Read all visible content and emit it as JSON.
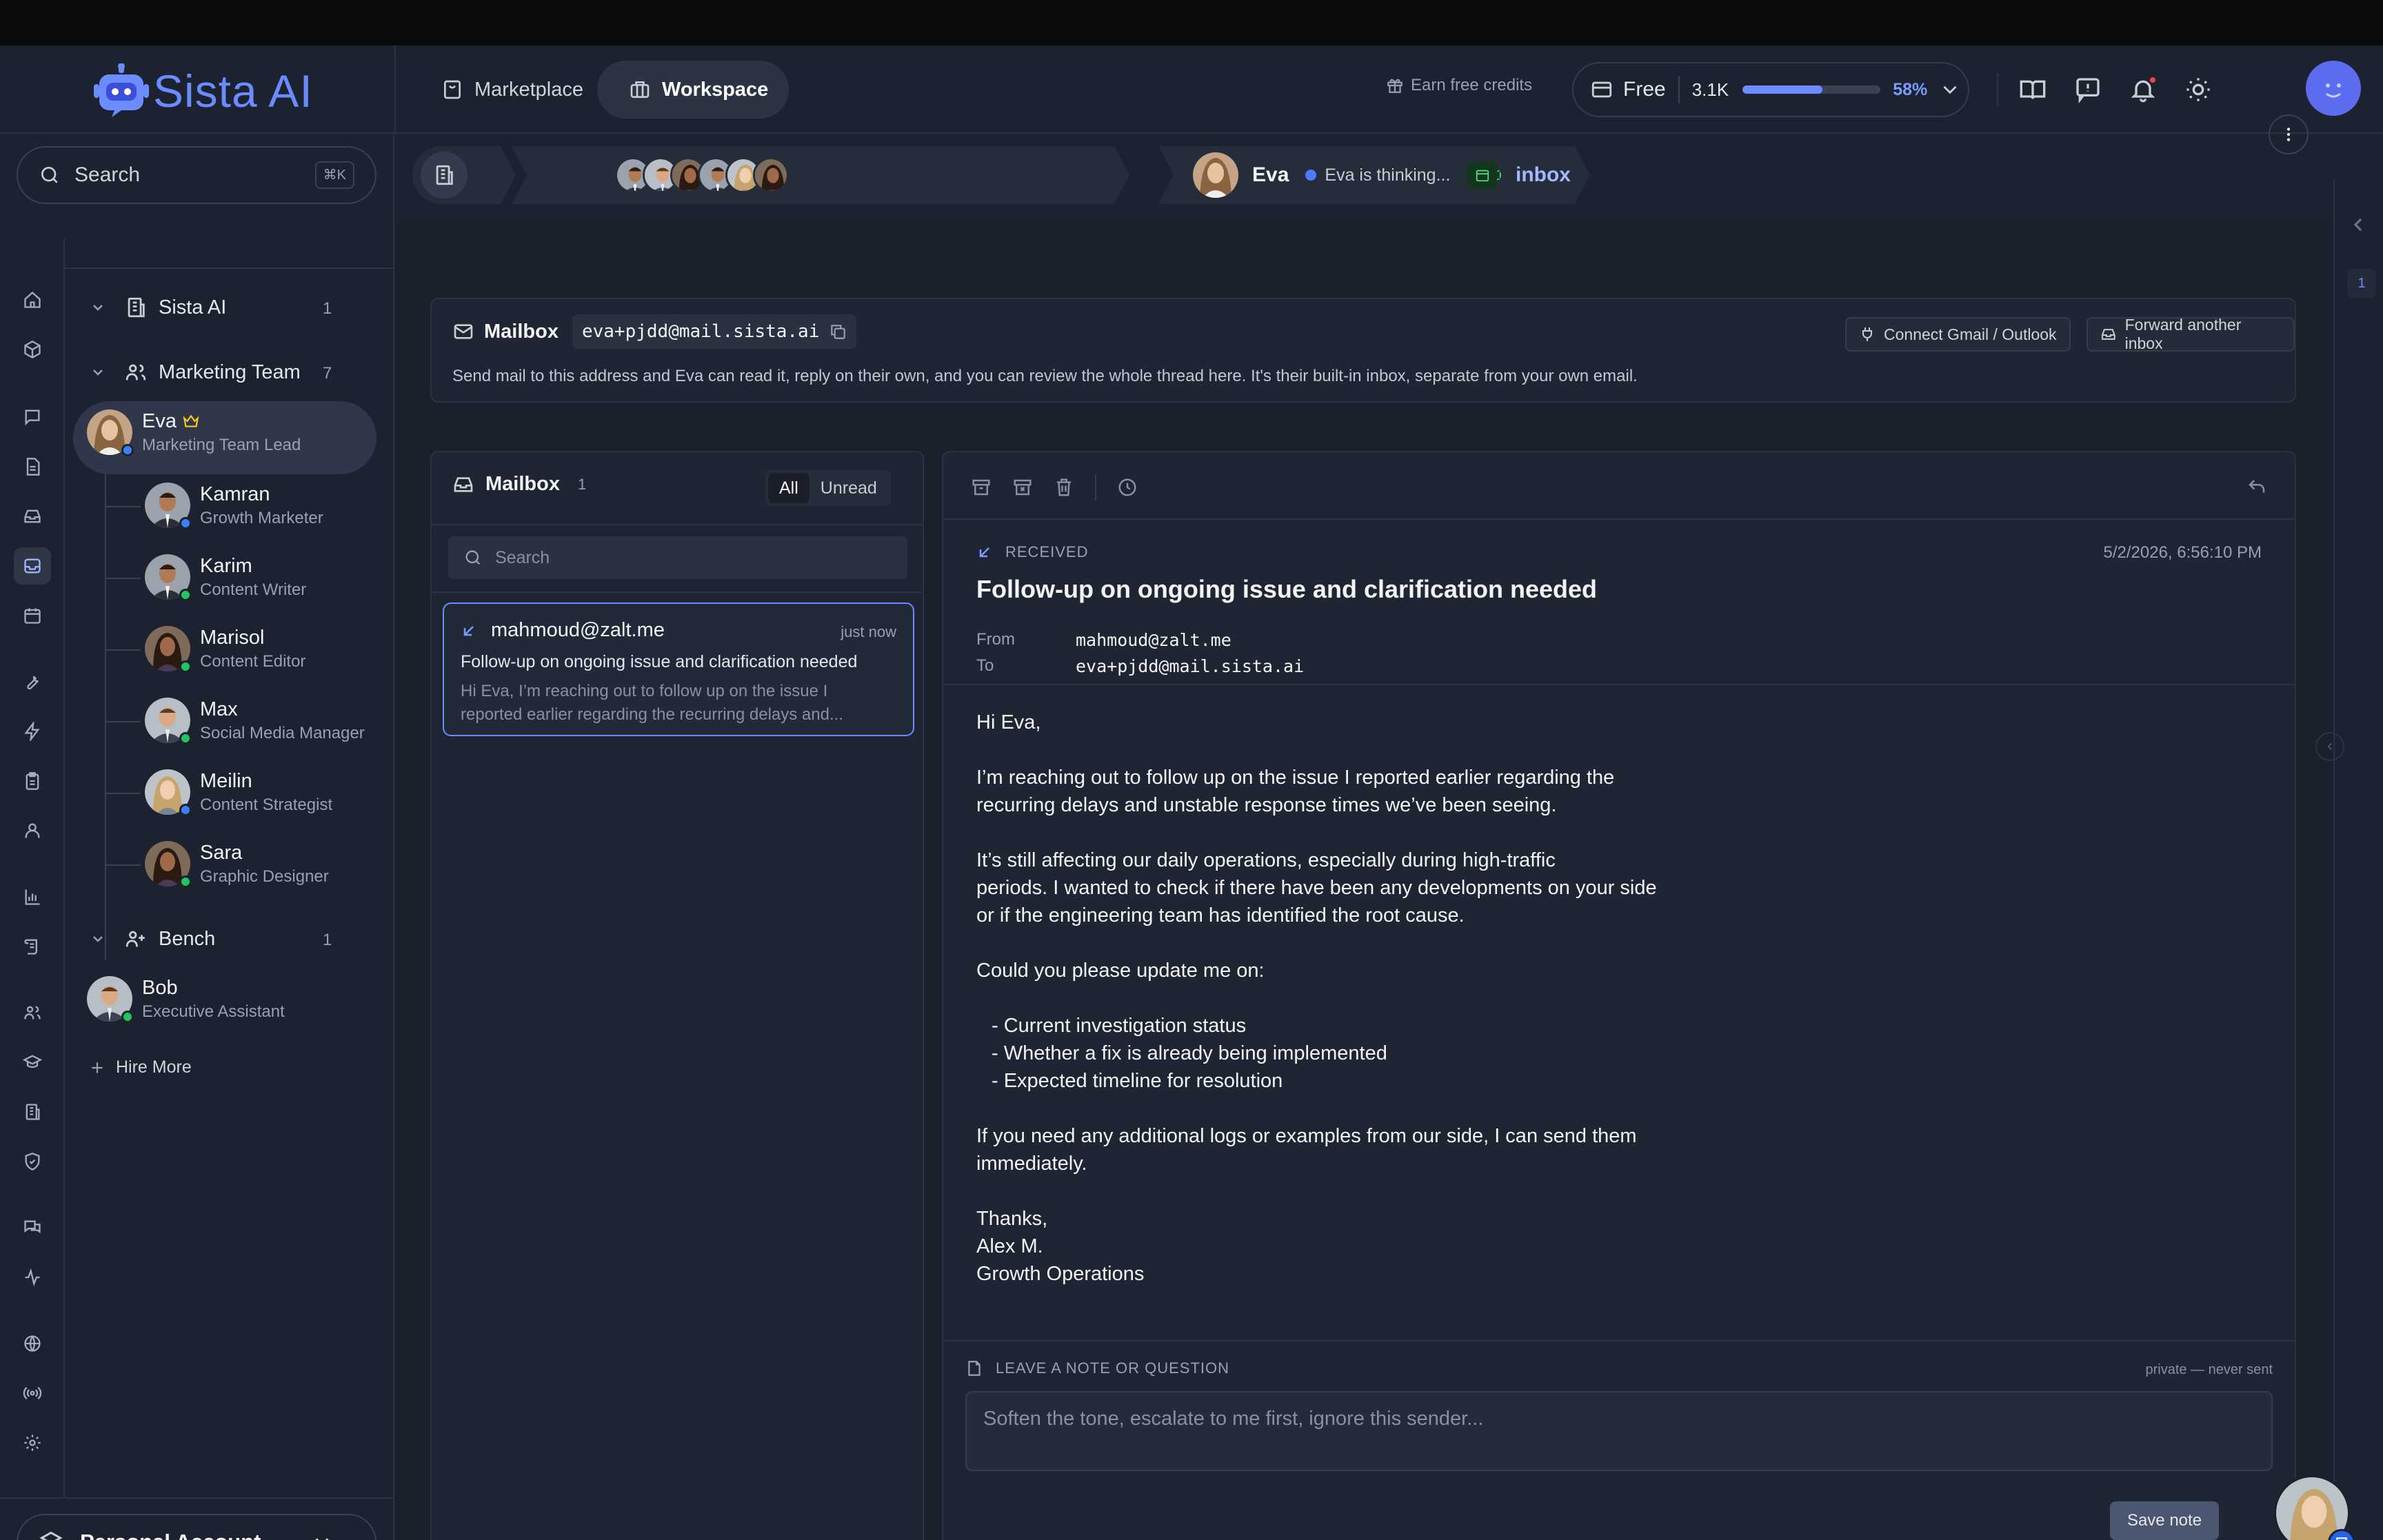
{
  "brand": {
    "name": "Sista AI",
    "color": "#6b8cff"
  },
  "header": {
    "tabs": [
      {
        "label": "Marketplace",
        "icon": "store-icon",
        "active": false
      },
      {
        "label": "Workspace",
        "icon": "briefcase-icon",
        "active": true
      }
    ],
    "earn_label": "Earn free credits",
    "plan": {
      "name": "Free",
      "credits": "3.1K",
      "usage_fraction": 0.58,
      "usage_label": "58%"
    },
    "icons": [
      "book-icon",
      "feedback-icon",
      "bell-icon",
      "sun-icon"
    ]
  },
  "sidebar": {
    "search": {
      "label": "Search",
      "shortcut": "⌘K"
    },
    "groups": {
      "org": {
        "name": "Sista AI",
        "count": "1"
      },
      "team": {
        "name": "Marketing Team",
        "count": "7"
      },
      "bench": {
        "name": "Bench",
        "count": "1"
      }
    },
    "members": [
      {
        "name": "Eva",
        "role": "Marketing Team Lead",
        "status": "busy",
        "lead": true
      },
      {
        "name": "Kamran",
        "role": "Growth Marketer",
        "status": "busy"
      },
      {
        "name": "Karim",
        "role": "Content Writer",
        "status": "online"
      },
      {
        "name": "Marisol",
        "role": "Content Editor",
        "status": "online"
      },
      {
        "name": "Max",
        "role": "Social Media Manager",
        "status": "online"
      },
      {
        "name": "Meilin",
        "role": "Content Strategist",
        "status": "busy"
      },
      {
        "name": "Sara",
        "role": "Graphic Designer",
        "status": "online"
      }
    ],
    "bench_members": [
      {
        "name": "Bob",
        "role": "Executive Assistant",
        "status": "online"
      }
    ],
    "hire_label": "Hire More",
    "account_label": "Personal Account"
  },
  "breadcrumb": {
    "agent": {
      "name": "Eva",
      "status": "Eva is thinking...",
      "badge": "1"
    },
    "current": "inbox"
  },
  "mailbox_banner": {
    "title": "Mailbox",
    "address": "eva+pjdd@mail.sista.ai",
    "description": "Send mail to this address and Eva can read it, reply on their own, and you can review the whole thread here. It's their built-in inbox, separate from your own email.",
    "connect_label": "Connect Gmail / Outlook",
    "forward_label": "Forward another inbox"
  },
  "mail_list": {
    "title": "Mailbox",
    "count": "1",
    "filters": [
      "All",
      "Unread"
    ],
    "active_filter": "All",
    "search_placeholder": "Search",
    "items": [
      {
        "from": "mahmoud@zalt.me",
        "time": "just now",
        "subject": "Follow-up on ongoing issue and clarification needed",
        "preview": "Hi Eva, I’m reaching out to follow up on the issue I reported earlier regarding the recurring delays and..."
      }
    ]
  },
  "message": {
    "direction": "RECEIVED",
    "date": "5/2/2026, 6:56:10 PM",
    "subject": "Follow-up on ongoing issue and clarification needed",
    "from_label": "From",
    "from": "mahmoud@zalt.me",
    "to_label": "To",
    "to": "eva+pjdd@mail.sista.ai",
    "body": {
      "greeting": "Hi Eva,",
      "p1a": "I’m reaching out to follow up on the issue I reported earlier regarding the",
      "p1b": "recurring delays and unstable response times we’ve been seeing.",
      "p2a": "It’s still affecting our daily operations, especially during high-traffic",
      "p2b": "periods. I wanted to check if there have been any developments on your side",
      "p2c": "or if the engineering team has identified the root cause.",
      "p3": "Could you please update me on:",
      "b1": "- Current investigation status",
      "b2": "- Whether a fix is already being implemented",
      "b3": "- Expected timeline for resolution",
      "p4a": "If you need any additional logs or examples from our side, I can send them",
      "p4b": "immediately.",
      "s1": "Thanks,",
      "s2": "Alex M.",
      "s3": "Growth Operations"
    }
  },
  "note": {
    "label": "LEAVE A NOTE OR QUESTION",
    "private_label": "private — never sent",
    "placeholder": "Soften the tone, escalate to me first, ignore this sender...",
    "save_label": "Save note"
  },
  "colors": {
    "accent": "#6b8cff",
    "online": "#22c55e",
    "busy": "#3b82f6",
    "danger": "#ef4444"
  }
}
